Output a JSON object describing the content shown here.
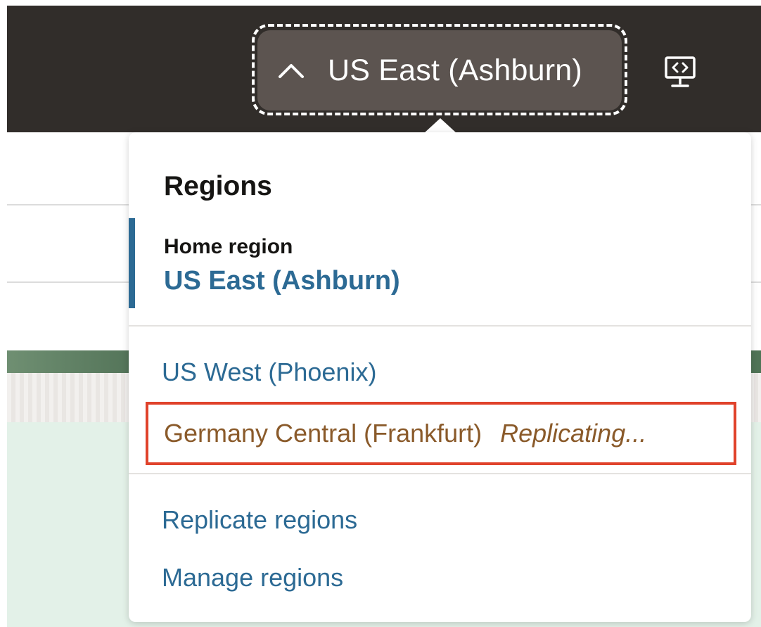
{
  "header": {
    "region_button_label": "US East (Ashburn)",
    "chevron_icon": "chevron-up-icon",
    "developer_icon": "developer-tools-icon"
  },
  "regions_menu": {
    "title": "Regions",
    "home": {
      "label": "Home region",
      "value": "US East (Ashburn)"
    },
    "subscribed": [
      {
        "name": "US West (Phoenix)"
      }
    ],
    "replicating": {
      "name": "Germany Central (Frankfurt)",
      "status": "Replicating..."
    },
    "actions": {
      "replicate": "Replicate regions",
      "manage": "Manage regions"
    }
  },
  "colors": {
    "header_bg": "#312d2a",
    "button_bg": "#5c5450",
    "link": "#2c6a94",
    "replicating_text": "#8a5a2a",
    "highlight_border": "#e0422b"
  }
}
